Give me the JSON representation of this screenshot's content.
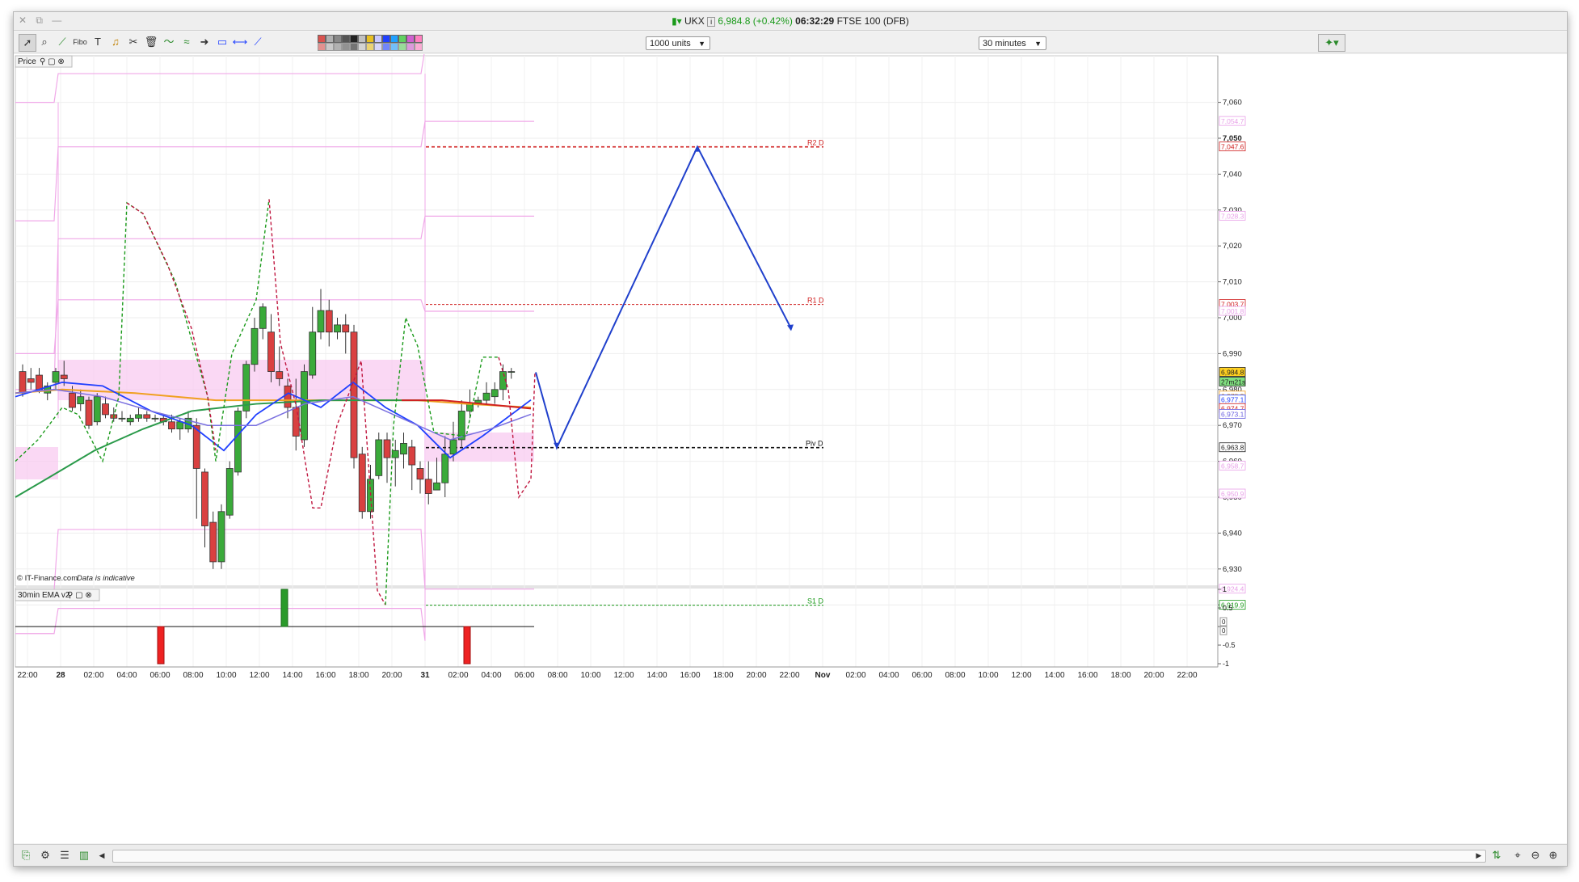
{
  "window": {
    "controls": "✕ ⧉ —",
    "symbol": "UKX",
    "price": "6,984.8 (+0.42%)",
    "time": "06:32:29",
    "instrument": "FTSE 100 (DFB)"
  },
  "toolbar": {
    "units_select": "1000 units",
    "timeframe_select": "30 minutes",
    "icons": [
      "pointer-icon",
      "zoom-icon",
      "trendline-icon",
      "fibonacci-icon",
      "text-icon",
      "alarm-bell-icon",
      "tools-icon",
      "trash-icon",
      "wave-icon",
      "measure-icon",
      "arrow-icon",
      "rectangle-icon",
      "horizontal-line-icon",
      "line-icon"
    ],
    "swatch_colors": [
      "#d9534f",
      "#b0b0b0",
      "#888888",
      "#555555",
      "#222222",
      "#c0c0c0",
      "#e8c020",
      "#c8c8ff",
      "#2040ff",
      "#20a0ff",
      "#60d060",
      "#d060d0",
      "#ff80c0"
    ]
  },
  "price_panel": {
    "label": "Price",
    "copyright": "© IT-Finance.com",
    "disclaimer": "Data is indicative"
  },
  "price_axis": {
    "ticks": [
      "7,060",
      "7,050",
      "7,040",
      "7,030",
      "7,020",
      "7,010",
      "7,000",
      "6,990",
      "6,980",
      "6,970",
      "6,960",
      "6,950",
      "6,940",
      "6,930",
      "6,920"
    ],
    "badges": [
      {
        "text": "7,054.7",
        "color": "#e8a0e8",
        "fill": "#fff"
      },
      {
        "text": "7,047.6",
        "color": "#d02020",
        "fill": "#fff"
      },
      {
        "text": "7,028.3",
        "color": "#e8a0e8",
        "fill": "#fff"
      },
      {
        "text": "7,003.7",
        "color": "#d02020",
        "fill": "#fff"
      },
      {
        "text": "7,001.8",
        "color": "#e8a0e8",
        "fill": "#fff"
      },
      {
        "text": "6,984.8",
        "color": "#222",
        "fill": "#ffd020"
      },
      {
        "text": "27m21s",
        "color": "#222",
        "fill": "#80e080"
      },
      {
        "text": "6,978.2",
        "color": "#f0a020",
        "fill": "#fff"
      },
      {
        "text": "6,977.1",
        "color": "#2040ff",
        "fill": "#fff"
      },
      {
        "text": "6,974.7",
        "color": "#d02020",
        "fill": "#fff"
      },
      {
        "text": "6,973.1",
        "color": "#6a60e0",
        "fill": "#fff"
      },
      {
        "text": "6,963.8",
        "color": "#222",
        "fill": "#fff"
      },
      {
        "text": "6,958.7",
        "color": "#e8a0e8",
        "fill": "#fff"
      },
      {
        "text": "6,950.9",
        "color": "#e8a0e8",
        "fill": "#fff"
      },
      {
        "text": "6,924.4",
        "color": "#e8a0e8",
        "fill": "#fff"
      },
      {
        "text": "6,919.9",
        "color": "#1a9a1a",
        "fill": "#fff"
      }
    ]
  },
  "pivot_labels": {
    "r2": "R2 D",
    "r1": "R1 D",
    "piv": "Piv D",
    "s1": "S1 D"
  },
  "indicator_panel": {
    "label": "30min EMA v2",
    "ticks": [
      "1",
      "0.5",
      "0",
      "-0.5",
      "-1"
    ],
    "badges": [
      "0",
      "0"
    ]
  },
  "time_axis": {
    "labels": [
      "22:00",
      "28",
      "02:00",
      "04:00",
      "06:00",
      "08:00",
      "10:00",
      "12:00",
      "14:00",
      "16:00",
      "18:00",
      "20:00",
      "31",
      "02:00",
      "04:00",
      "06:00",
      "08:00",
      "10:00",
      "12:00",
      "14:00",
      "16:00",
      "18:00",
      "20:00",
      "22:00",
      "Nov",
      "02:00",
      "04:00",
      "06:00",
      "08:00",
      "10:00",
      "12:00",
      "14:00",
      "16:00",
      "18:00",
      "20:00",
      "22:00"
    ],
    "bold": [
      "28",
      "31",
      "Nov"
    ]
  },
  "bottom_icons": [
    "new-chart-icon",
    "settings-icon",
    "list-icon",
    "bars-icon",
    "scroll-left-icon",
    "scroll-right-icon",
    "chart-type-icon",
    "zoom-fit-icon",
    "zoom-out-icon",
    "zoom-in-icon"
  ]
}
